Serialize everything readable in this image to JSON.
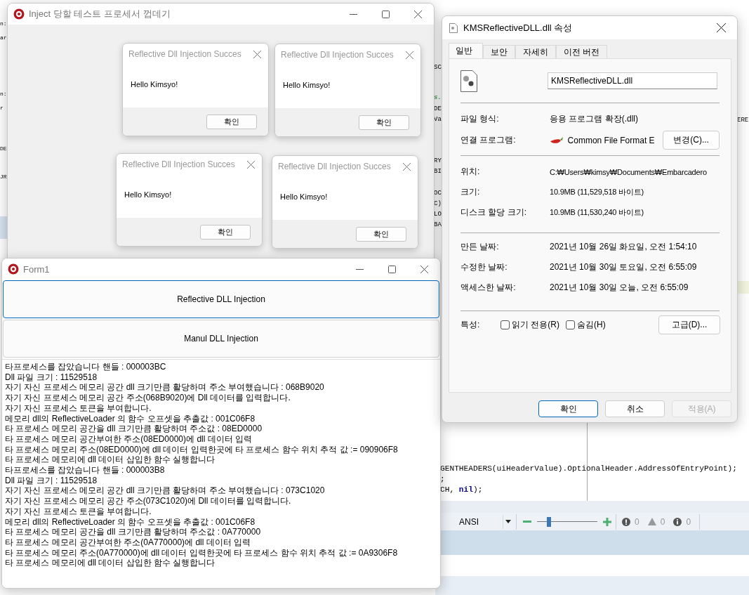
{
  "ide": {
    "left_fragments": [
      "n:",
      "ar",
      "n:",
      "r",
      "DE",
      "JR"
    ],
    "right_fragments": [
      {
        "text": "SC",
        "kind": "plain"
      },
      {
        "text": "s.",
        "kind": "comment"
      },
      {
        "text": "DE",
        "kind": "plain"
      },
      {
        "text": "Va",
        "kind": "plain"
      },
      {
        "text": "RY",
        "kind": "plain"
      },
      {
        "text": "BI",
        "kind": "plain"
      },
      {
        "text": "OC",
        "kind": "plain"
      },
      {
        "text": "C)",
        "kind": "plain"
      },
      {
        "text": "LO",
        "kind": "plain"
      },
      {
        "text": "BA",
        "kind": "plain"
      }
    ],
    "far_fragment": "ERE",
    "code_lines": [
      "GENTHEADERS(uiHeaderValue).OptionalHeader.AddressOfEntryPoint);",
      ";",
      "CH, **nil**);"
    ],
    "status_bar": {
      "encoding": "ANSI",
      "zoom": {
        "level": 0.2
      },
      "errors": "0",
      "warnings": "0",
      "hints": "0"
    }
  },
  "inject_window": {
    "title": "Inject 당할 테스트 프로세서 껍데기",
    "message_boxes": [
      {
        "title": "Reflective Dll Injection Succes",
        "message": "Hello Kimsyo!",
        "button": "확인"
      },
      {
        "title": "Reflective Dll Injection Succes",
        "message": "Hello Kimsyo!",
        "button": "확인"
      },
      {
        "title": "Reflective Dll Injection Succes",
        "message": "Hello Kimsyo!",
        "button": "확인"
      },
      {
        "title": "Reflective Dll Injection Succes",
        "message": "Hello Kimsyo!",
        "button": "확인"
      }
    ]
  },
  "form1": {
    "title": "Form1",
    "buttons": [
      {
        "label": "Reflective DLL Injection",
        "focused": true
      },
      {
        "label": "Manul DLL Injection",
        "focused": false
      }
    ],
    "log": [
      "타프로세스를 잡았습니다 핸들 : 000003BC",
      "Dll 파일 크기 : 11529518",
      "자기 자신 프로세스 메모리 공간 dll 크기만큼 활당하며 주소 부여했습니다  : 068B9020",
      "자기 자신 프로세스 메모리 공간 주소(068B9020)에 Dll 데이터를 입력합니다.",
      "자기 자신 프로세스 토큰을 부여합니다.",
      "메모리 dll의 ReflectiveLoader 의 함수 오프셋을 추출값 : 001C06F8",
      "타 프로세스 메모리 공간을 dll 크기만큼 활당하며 주소값 : 08ED0000",
      "타 프로세스 메모리 공간부여한 주소(08ED0000)에 dll 데이터 입력",
      "타 프로세스 메모리 주소(08ED0000)에 dll 데이터 입력한곳에 타 프로세스 함수 위치 추적 값 := 090906F8",
      "타 프로세스 메모리에 dll 데이터 삽입한 함수 실행합니다",
      "타프로세스를 잡았습니다 핸들 : 000003B8",
      "Dll 파일 크기 : 11529518",
      "자기 자신 프로세스 메모리 공간 dll 크기만큼 활당하며 주소 부여했습니다  : 073C1020",
      "자기 자신 프로세스 메모리 공간 주소(073C1020)에 Dll 데이터를 입력합니다.",
      "자기 자신 프로세스 토큰을 부여합니다.",
      "메모리 dll의 ReflectiveLoader 의 함수 오프셋을 추출값 : 001C06F8",
      "타 프로세스 메모리 공간을 dll 크기만큼 활당하며 주소값 : 0A770000",
      "타 프로세스 메모리 공간부여한 주소(0A770000)에 dll 데이터 입력",
      "타 프로세스 메모리 주소(0A770000)에 dll 데이터 입력한곳에 타 프로세스 함수 위치 추적 값 := 0A9306F8",
      "타 프로세스 메모리에 dll 데이터 삽입한 함수 실행합니다"
    ]
  },
  "properties": {
    "title": "KMSReflectiveDLL.dll 속성",
    "tabs": [
      {
        "label": "일반",
        "selected": true
      },
      {
        "label": "보안",
        "selected": false
      },
      {
        "label": "자세히",
        "selected": false
      },
      {
        "label": "이전 버전",
        "selected": false
      }
    ],
    "file_name": "KMSReflectiveDLL.dll",
    "type_label": "파일 형식:",
    "type_value": "응용 프로그램 확장(.dll)",
    "opens_with_label": "연결 프로그램:",
    "opens_with_value": "Common File Format E",
    "change_button": "변경(C)...",
    "info_rows": [
      {
        "label": "위치:",
        "value": "C:₩Users₩kimsy₩Documents₩Embarcadero"
      },
      {
        "label": "크기:",
        "value": "10.9MB (11,529,518 바이트)"
      },
      {
        "label": "디스크 할당 크기:",
        "value": "10.9MB (11,530,240 바이트)"
      }
    ],
    "date_rows": [
      {
        "label": "만든 날짜:",
        "value": "2021년 10월 26일 화요일, 오전 1:54:10"
      },
      {
        "label": "수정한 날짜:",
        "value": "2021년 10월 30일 토요일, 오전 6:55:09"
      },
      {
        "label": "액세스한 날짜:",
        "value": "2021년 10월 30일 오늘, 오전 6:55:09"
      }
    ],
    "attributes_label": "특성:",
    "attributes": [
      {
        "label": "읽기 전용(R)",
        "checked": false
      },
      {
        "label": "숨김(H)",
        "checked": false
      }
    ],
    "advanced_button": "고급(D)...",
    "buttons": [
      {
        "label": "확인",
        "default": true,
        "disabled": false
      },
      {
        "label": "취소",
        "default": false,
        "disabled": false
      },
      {
        "label": "적용(A)",
        "default": false,
        "disabled": true
      }
    ]
  }
}
